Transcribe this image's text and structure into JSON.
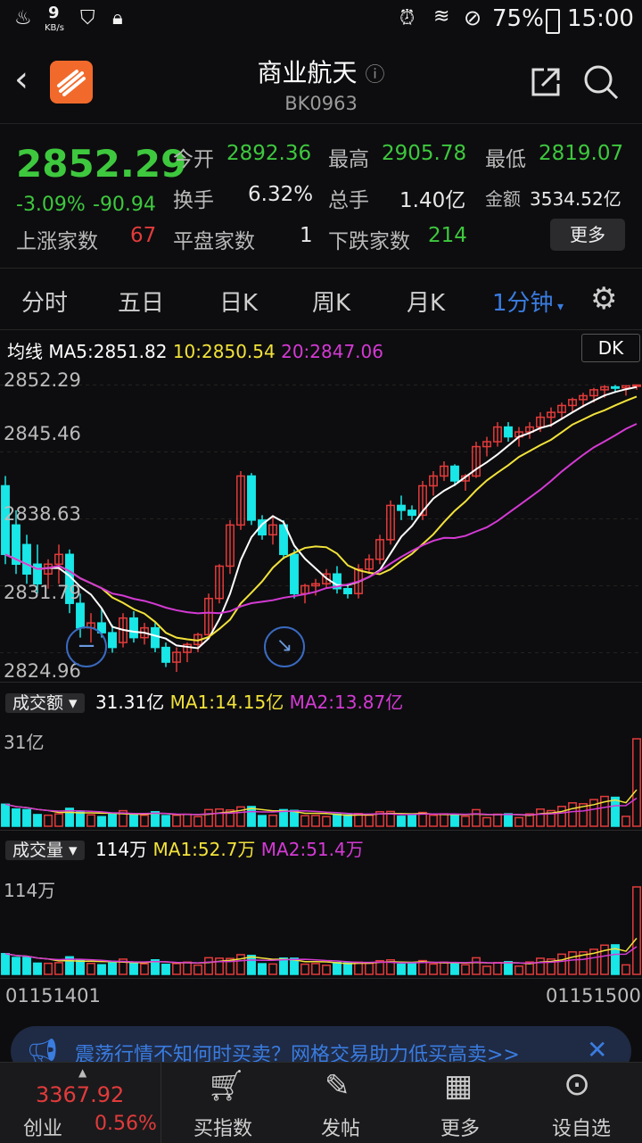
{
  "status": {
    "net_speed": "9",
    "net_unit": "KB/s",
    "battery": "75%",
    "time": "15:00"
  },
  "header": {
    "title": "商业航天",
    "code": "BK0963"
  },
  "quote": {
    "price": "2852.29",
    "pct": "-3.09%",
    "chg": "-90.94",
    "open_label": "今开",
    "open": "2892.36",
    "high_label": "最高",
    "high": "2905.78",
    "low_label": "最低",
    "low": "2819.07",
    "turnover_label": "换手",
    "turnover": "6.32%",
    "hands_label": "总手",
    "hands": "1.40亿",
    "amount_label": "金额",
    "amount": "3534.52亿",
    "up_label": "上涨家数",
    "up": "67",
    "flat_label": "平盘家数",
    "flat": "1",
    "down_label": "下跌家数",
    "down": "214",
    "more": "更多"
  },
  "tabs": [
    "分时",
    "五日",
    "日K",
    "周K",
    "月K",
    "1分钟"
  ],
  "ma_bar": {
    "label": "均线",
    "ma5": "MA5:2851.82",
    "ma10": "10:2850.54",
    "ma20": "20:2847.06",
    "dk": "DK"
  },
  "price_axis": [
    "2852.29",
    "2845.46",
    "2838.63",
    "2831.79",
    "2824.96"
  ],
  "amount_panel": {
    "selector": "成交额",
    "value": "31.31亿",
    "ma1": "MA1:14.15亿",
    "ma2": "MA2:13.87亿",
    "axis_top": "31亿"
  },
  "volume_panel": {
    "selector": "成交量",
    "value": "114万",
    "ma1": "MA1:52.7万",
    "ma2": "MA2:51.4万",
    "axis_top": "114万"
  },
  "time_axis": {
    "start": "01151401",
    "end": "01151500"
  },
  "banner": {
    "text": "震荡行情不知何时买卖？网格交易助力低买高卖>>"
  },
  "bottom": {
    "index_value": "3367.92",
    "index_name": "创业",
    "index_pct": "0.56%",
    "buy": "买指数",
    "post": "发帖",
    "more": "更多",
    "watch": "设自选"
  },
  "colors": {
    "up": "#e23b3b",
    "down": "#3ec83e",
    "cyan": "#19e6e6",
    "ma5": "#ffffff",
    "ma10": "#f2e23a",
    "ma20": "#d43ad4",
    "accent": "#3a7ce0"
  },
  "chart_data": {
    "type": "candlestick",
    "y_range": [
      2824.96,
      2852.29
    ],
    "bars_count": 60,
    "candles": [
      [
        2842.0,
        2843.0,
        2834.0,
        2835.0
      ],
      [
        2838.0,
        2839.5,
        2833.0,
        2834.0
      ],
      [
        2836.0,
        2837.0,
        2832.0,
        2833.0
      ],
      [
        2834.0,
        2836.0,
        2831.0,
        2832.0
      ],
      [
        2833.0,
        2834.5,
        2831.5,
        2834.0
      ],
      [
        2834.0,
        2836.0,
        2832.0,
        2835.0
      ],
      [
        2835.0,
        2835.5,
        2829.0,
        2830.0
      ],
      [
        2830.0,
        2831.0,
        2826.5,
        2827.5
      ],
      [
        2827.5,
        2829.0,
        2826.0,
        2828.0
      ],
      [
        2828.0,
        2829.5,
        2826.5,
        2827.0
      ],
      [
        2827.0,
        2827.8,
        2824.96,
        2825.5
      ],
      [
        2826.0,
        2829.0,
        2825.5,
        2828.5
      ],
      [
        2828.5,
        2829.2,
        2826.0,
        2826.5
      ],
      [
        2826.5,
        2828.0,
        2825.8,
        2827.5
      ],
      [
        2827.5,
        2828.0,
        2825.0,
        2825.5
      ],
      [
        2825.5,
        2826.0,
        2823.5,
        2824.0
      ],
      [
        2824.0,
        2825.5,
        2823.0,
        2825.0
      ],
      [
        2825.0,
        2826.0,
        2824.0,
        2825.8
      ],
      [
        2825.8,
        2827.0,
        2825.0,
        2826.8
      ],
      [
        2826.8,
        2831.0,
        2826.5,
        2830.5
      ],
      [
        2830.5,
        2834.0,
        2830.0,
        2833.8
      ],
      [
        2833.8,
        2838.5,
        2833.0,
        2838.0
      ],
      [
        2838.0,
        2843.5,
        2837.5,
        2843.0
      ],
      [
        2843.0,
        2843.3,
        2838.0,
        2838.5
      ],
      [
        2838.5,
        2839.0,
        2836.5,
        2837.0
      ],
      [
        2837.0,
        2839.0,
        2836.0,
        2838.0
      ],
      [
        2838.0,
        2838.5,
        2834.5,
        2835.0
      ],
      [
        2835.0,
        2835.5,
        2830.5,
        2831.0
      ],
      [
        2831.0,
        2832.0,
        2830.0,
        2831.8
      ],
      [
        2831.8,
        2832.5,
        2830.8,
        2832.0
      ],
      [
        2832.0,
        2833.5,
        2831.5,
        2833.0
      ],
      [
        2833.0,
        2833.8,
        2831.0,
        2831.5
      ],
      [
        2831.5,
        2832.0,
        2830.5,
        2831.0
      ],
      [
        2831.0,
        2834.0,
        2830.5,
        2833.5
      ],
      [
        2833.5,
        2835.0,
        2833.0,
        2834.5
      ],
      [
        2834.5,
        2837.0,
        2834.0,
        2836.5
      ],
      [
        2836.5,
        2840.5,
        2836.0,
        2840.0
      ],
      [
        2840.0,
        2841.0,
        2838.5,
        2839.5
      ],
      [
        2839.5,
        2840.0,
        2838.5,
        2839.0
      ],
      [
        2839.0,
        2842.5,
        2838.5,
        2842.0
      ],
      [
        2842.0,
        2843.5,
        2841.0,
        2843.0
      ],
      [
        2843.0,
        2844.5,
        2842.5,
        2844.0
      ],
      [
        2844.0,
        2844.2,
        2842.0,
        2842.5
      ],
      [
        2842.5,
        2843.2,
        2841.5,
        2843.0
      ],
      [
        2843.0,
        2846.5,
        2842.8,
        2846.0
      ],
      [
        2846.0,
        2847.0,
        2845.0,
        2846.5
      ],
      [
        2846.5,
        2848.5,
        2846.0,
        2848.0
      ],
      [
        2848.0,
        2848.5,
        2846.5,
        2847.0
      ],
      [
        2847.0,
        2848.0,
        2846.0,
        2847.5
      ],
      [
        2847.5,
        2848.5,
        2846.8,
        2848.0
      ],
      [
        2848.0,
        2849.5,
        2847.5,
        2849.0
      ],
      [
        2849.0,
        2850.0,
        2848.0,
        2849.5
      ],
      [
        2849.5,
        2850.5,
        2848.8,
        2850.2
      ],
      [
        2850.2,
        2851.0,
        2849.5,
        2850.8
      ],
      [
        2850.8,
        2851.5,
        2850.0,
        2851.2
      ],
      [
        2851.2,
        2852.0,
        2850.5,
        2851.8
      ],
      [
        2851.8,
        2852.29,
        2851.0,
        2852.1
      ],
      [
        2852.1,
        2852.29,
        2851.5,
        2852.0
      ],
      [
        2852.0,
        2852.29,
        2851.2,
        2852.2
      ],
      [
        2852.2,
        2852.29,
        2851.8,
        2852.29
      ]
    ]
  }
}
